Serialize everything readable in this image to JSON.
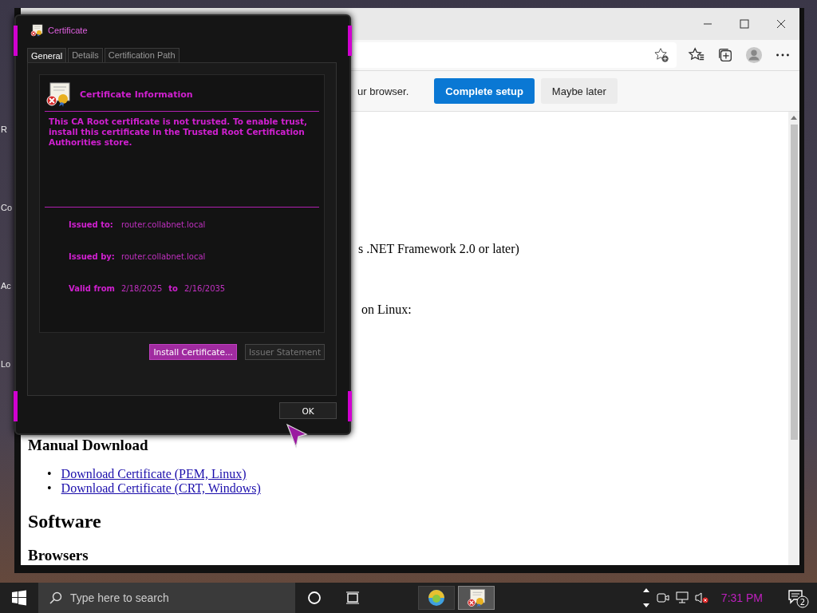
{
  "desktop": {
    "icon_labels": [
      "R",
      "Co",
      "Ac",
      "Lo"
    ]
  },
  "browser": {
    "banner": {
      "text": "ur browser.",
      "buttons": [
        {
          "label": "Complete setup",
          "kind": "primary"
        },
        {
          "label": "Maybe later",
          "kind": "secondary"
        }
      ]
    },
    "content": [
      {
        "kind": "text",
        "text": "s .NET Framework 2.0 or later)"
      },
      {
        "kind": "text",
        "text": "on Linux:"
      },
      {
        "kind": "h3",
        "text": "Manual Download"
      },
      {
        "kind": "link",
        "bullet": "•",
        "text": "Download Certificate (PEM, Linux)"
      },
      {
        "kind": "link",
        "bullet": "•",
        "text": "Download Certificate (CRT, Windows)"
      },
      {
        "kind": "h2",
        "text": "Software"
      },
      {
        "kind": "h3",
        "text": "Browsers"
      }
    ]
  },
  "dialog": {
    "title": "Certificate",
    "tabs": [
      {
        "label": "General",
        "selected": true
      },
      {
        "label": "Details",
        "selected": false
      },
      {
        "label": "Certification Path",
        "selected": false
      }
    ],
    "heading": "Certificate Information",
    "message": "This CA Root certificate is not trusted. To enable trust, install this certificate in the Trusted Root Certification Authorities store.",
    "fields": [
      {
        "label": "Issued to:",
        "value": "router.collabnet.local"
      },
      {
        "label": "Issued by:",
        "value": "router.collabnet.local"
      }
    ],
    "validity": {
      "label": "Valid from",
      "from": "2/18/2025",
      "to_label": "to",
      "to": "2/16/2035"
    },
    "buttons": [
      {
        "label": "Install Certificate...",
        "disabled": false
      },
      {
        "label": "Issuer Statement",
        "disabled": true
      }
    ],
    "ok": "OK"
  },
  "taskbar": {
    "search": {
      "placeholder": "Type here to search"
    },
    "apps": [
      {
        "kind": "browser",
        "selected": false
      },
      {
        "kind": "certificate",
        "selected": true
      }
    ],
    "clock": "7:31 PM",
    "notifications": "2"
  }
}
